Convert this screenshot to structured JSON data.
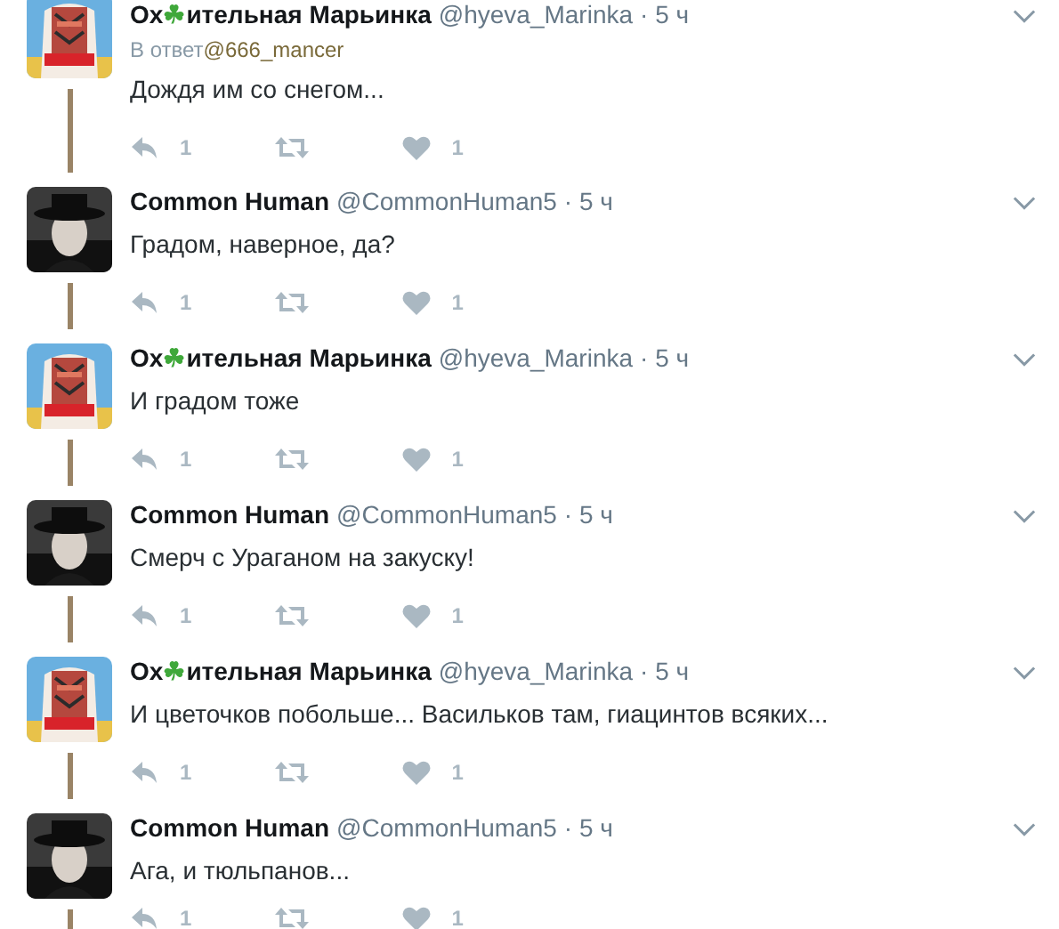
{
  "tweets": [
    {
      "kind": "marinka",
      "name": [
        {
          "kind": "text",
          "text": "Ох"
        },
        {
          "kind": "emoji",
          "text": "☘"
        },
        {
          "kind": "text",
          "text": "ительная Марьинка"
        }
      ],
      "handle": "@hyeva_Marinka",
      "time": "· 5 ч",
      "reply_to": {
        "label": "В ответ",
        "handle": "@666_mancer"
      },
      "text": "Дождя им со снегом...",
      "replies": "1",
      "likes": "1",
      "thread_line": true
    },
    {
      "kind": "human",
      "name": [
        {
          "kind": "text",
          "text": "Common Human"
        }
      ],
      "handle": "@CommonHuman5",
      "time": "· 5 ч",
      "text": "Градом, наверное, да?",
      "replies": "1",
      "likes": "1",
      "thread_line": true
    },
    {
      "kind": "marinka",
      "name": [
        {
          "kind": "text",
          "text": "Ох"
        },
        {
          "kind": "emoji",
          "text": "☘"
        },
        {
          "kind": "text",
          "text": "ительная Марьинка"
        }
      ],
      "handle": "@hyeva_Marinka",
      "time": "· 5 ч",
      "text": "И градом тоже",
      "replies": "1",
      "likes": "1",
      "thread_line": true
    },
    {
      "kind": "human",
      "name": [
        {
          "kind": "text",
          "text": "Common Human"
        }
      ],
      "handle": "@CommonHuman5",
      "time": "· 5 ч",
      "text": "Смерч с Ураганом на закуску!",
      "replies": "1",
      "likes": "1",
      "thread_line": true
    },
    {
      "kind": "marinka",
      "name": [
        {
          "kind": "text",
          "text": "Ох"
        },
        {
          "kind": "emoji",
          "text": "☘"
        },
        {
          "kind": "text",
          "text": "ительная Марьинка"
        }
      ],
      "handle": "@hyeva_Marinka",
      "time": "· 5 ч",
      "text": "И цветочков побольше... Васильков там, гиацинтов всяких...",
      "replies": "1",
      "likes": "1",
      "thread_line": true
    },
    {
      "kind": "human",
      "name": [
        {
          "kind": "text",
          "text": "Common Human"
        }
      ],
      "handle": "@CommonHuman5",
      "time": "· 5 ч",
      "text": "Ага, и тюльпанов...",
      "replies": "1",
      "likes": "1",
      "thread_line": true
    }
  ]
}
